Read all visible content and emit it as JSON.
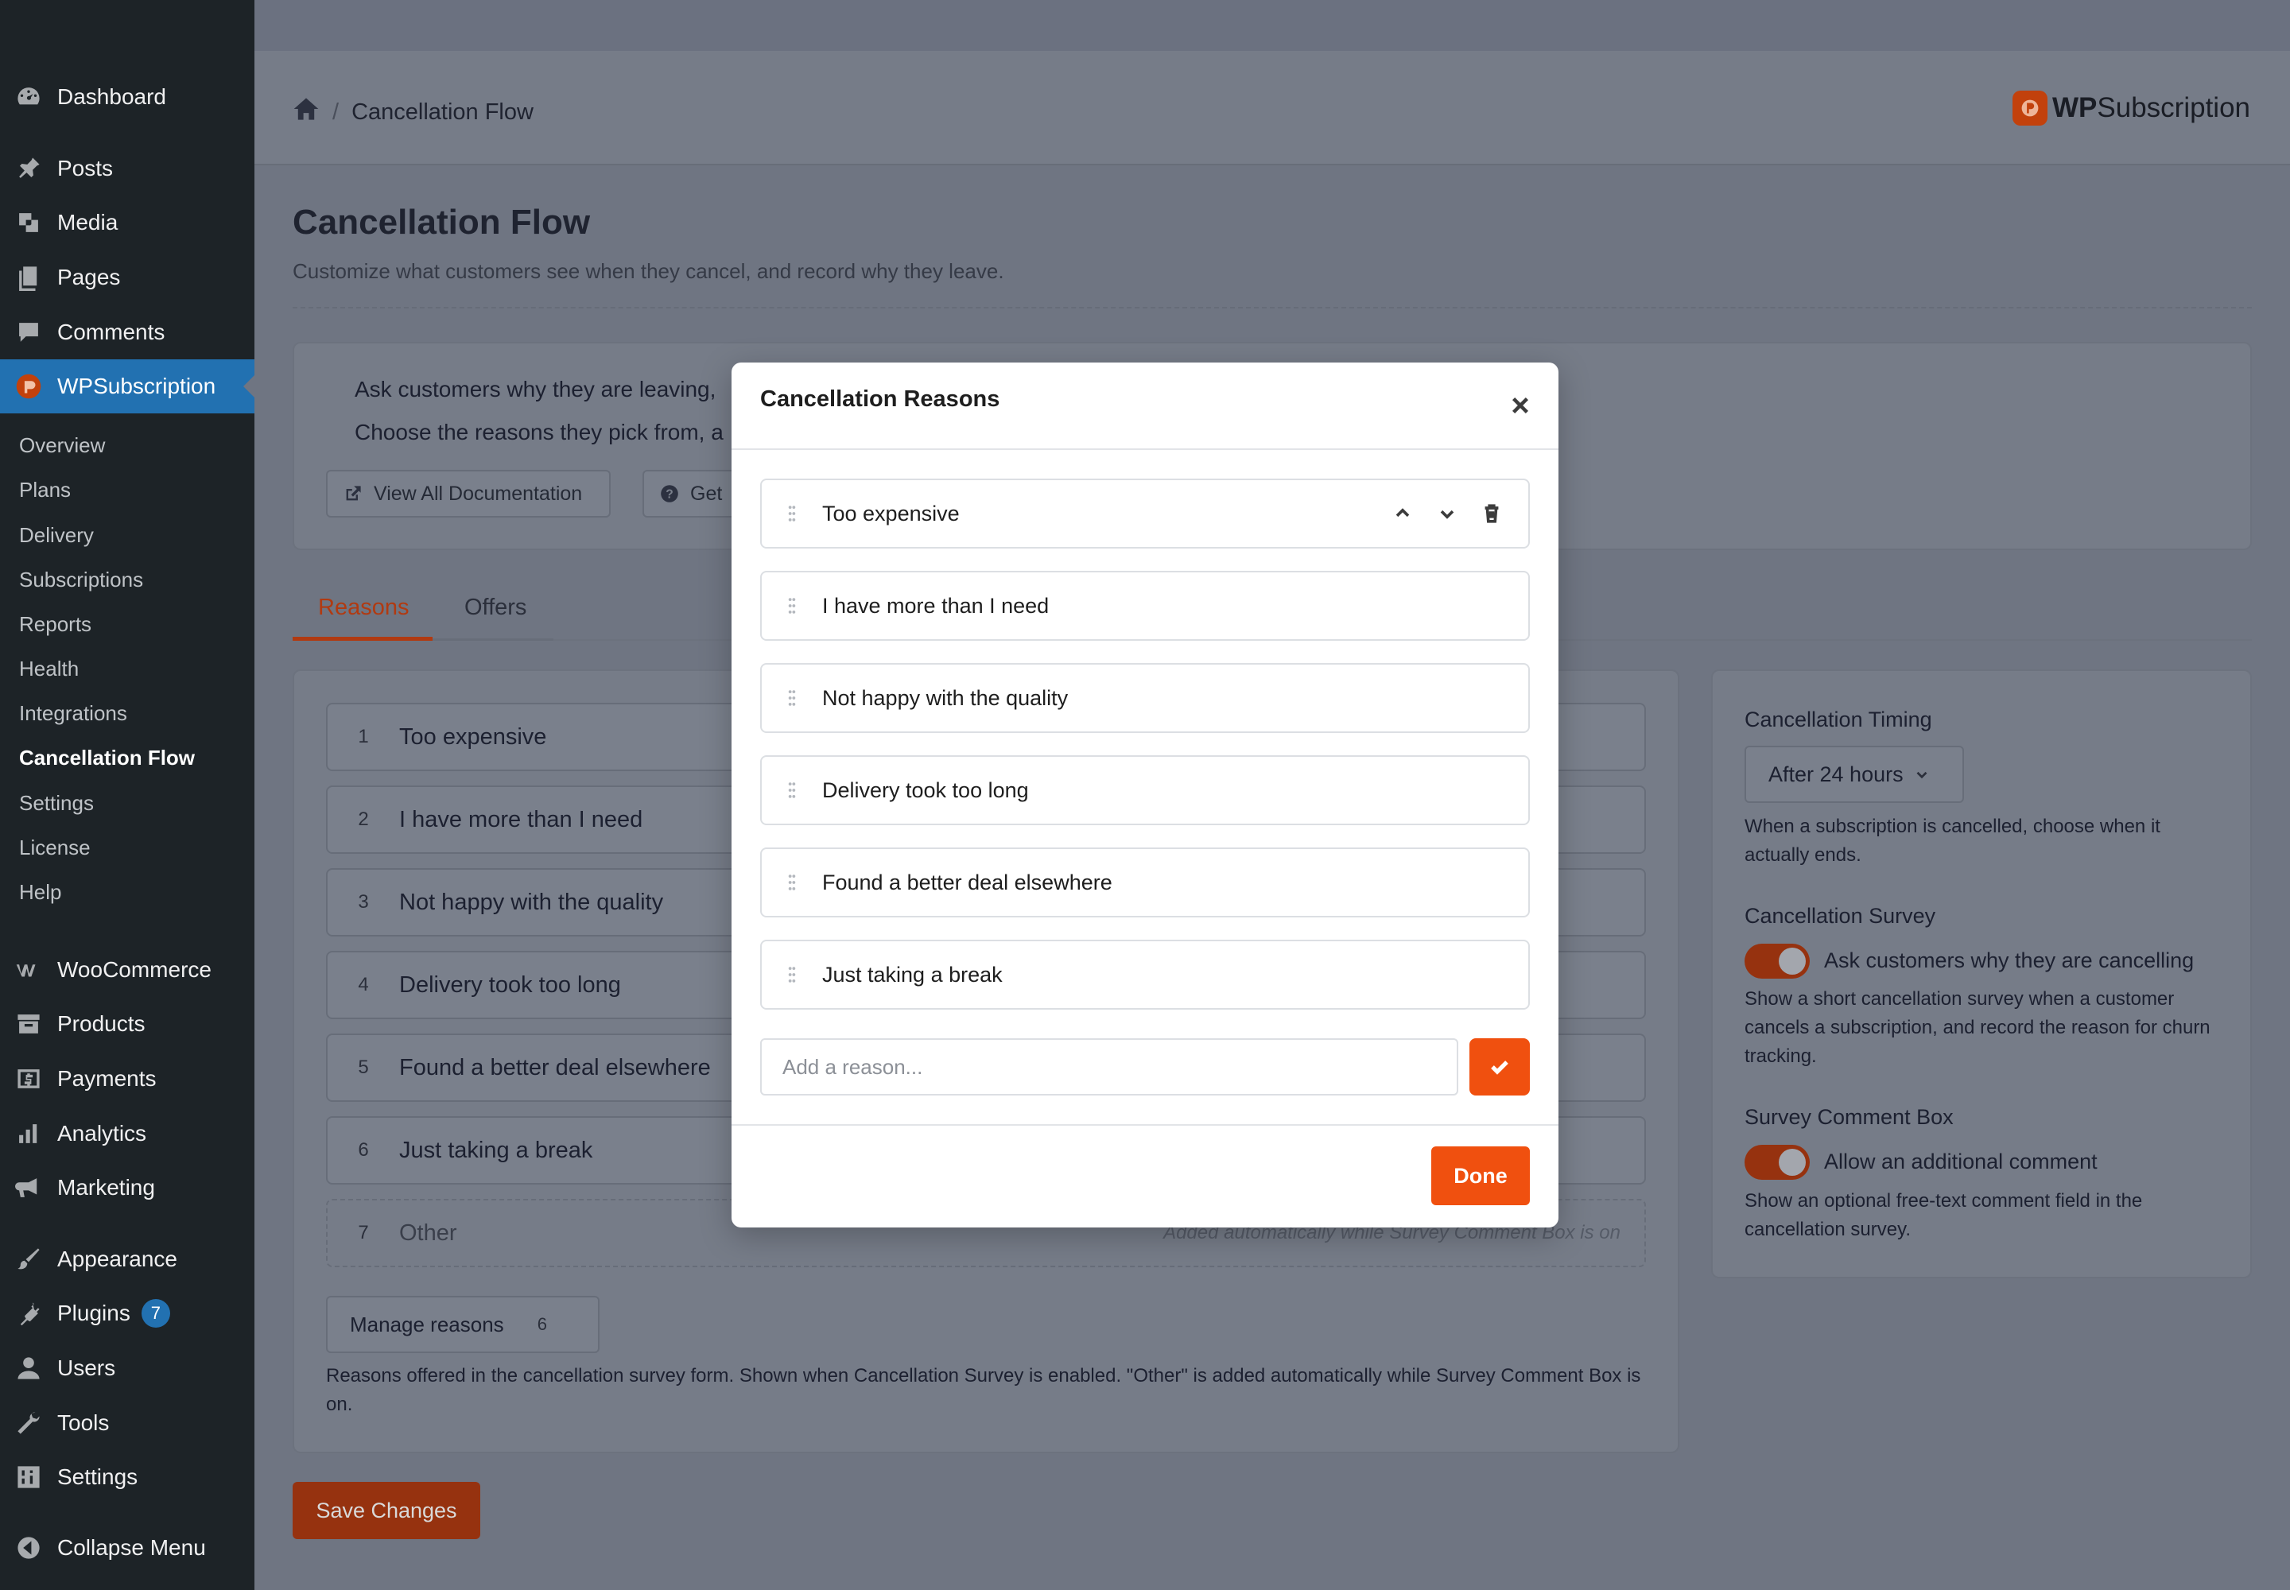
{
  "sidebar": {
    "menu": [
      {
        "label": "Dashboard",
        "icon": "dashboard-icon"
      },
      {
        "label": "Posts",
        "icon": "pin-icon"
      },
      {
        "label": "Media",
        "icon": "media-icon"
      },
      {
        "label": "Pages",
        "icon": "pages-icon"
      },
      {
        "label": "Comments",
        "icon": "comment-icon"
      },
      {
        "label": "WPSubscription",
        "icon": "wpsubscription-icon"
      }
    ],
    "submenu": [
      "Overview",
      "Plans",
      "Delivery",
      "Subscriptions",
      "Reports",
      "Health",
      "Integrations",
      "Cancellation Flow",
      "Settings",
      "License",
      "Help"
    ],
    "menu2": [
      {
        "label": "WooCommerce",
        "icon": "woocommerce-icon"
      },
      {
        "label": "Products",
        "icon": "archive-icon"
      },
      {
        "label": "Payments",
        "icon": "dollar-icon"
      },
      {
        "label": "Analytics",
        "icon": "chart-icon"
      },
      {
        "label": "Marketing",
        "icon": "megaphone-icon"
      },
      {
        "label": "Appearance",
        "icon": "brush-icon"
      },
      {
        "label": "Plugins",
        "icon": "plugin-icon",
        "badge": "7"
      },
      {
        "label": "Users",
        "icon": "user-icon"
      },
      {
        "label": "Tools",
        "icon": "wrench-icon"
      },
      {
        "label": "Settings",
        "icon": "settings-icon"
      },
      {
        "label": "Collapse Menu",
        "icon": "collapse-icon"
      }
    ]
  },
  "header": {
    "breadcrumb": "Cancellation Flow",
    "brand_bold": "WP",
    "brand_rest": "Subscription"
  },
  "page": {
    "title": "Cancellation Flow",
    "subtitle": "Customize what customers see when they cancel, and record why they leave."
  },
  "info": {
    "line1": "Ask customers why they are leaving,",
    "line2": "Choose the reasons they pick from, a",
    "docs_button": "View All Documentation",
    "help_button": "Get"
  },
  "tabs": {
    "reasons": "Reasons",
    "offers": "Offers"
  },
  "reasons": [
    {
      "num": "1",
      "label": "Too expensive"
    },
    {
      "num": "2",
      "label": "I have more than I need"
    },
    {
      "num": "3",
      "label": "Not happy with the quality"
    },
    {
      "num": "4",
      "label": "Delivery took too long"
    },
    {
      "num": "5",
      "label": "Found a better deal elsewhere"
    },
    {
      "num": "6",
      "label": "Just taking a break"
    },
    {
      "num": "7",
      "label": "Other",
      "note": "Added automatically while Survey Comment Box is on"
    }
  ],
  "manage": {
    "label": "Manage reasons",
    "count": "6"
  },
  "reasons_desc": "Reasons offered in the cancellation survey form. Shown when Cancellation Survey is enabled. \"Other\" is added automatically while Survey Comment Box is on.",
  "save_label": "Save Changes",
  "settings": {
    "timing_label": "Cancellation Timing",
    "timing_value": "After 24 hours",
    "timing_help": "When a subscription is cancelled, choose when it actually ends.",
    "survey_label": "Cancellation Survey",
    "survey_toggle": "Ask customers why they are cancelling",
    "survey_help": "Show a short cancellation survey when a customer cancels a subscription, and record the reason for churn tracking.",
    "comment_label": "Survey Comment Box",
    "comment_toggle": "Allow an additional comment",
    "comment_help": "Show an optional free-text comment field in the cancellation survey."
  },
  "modal": {
    "title": "Cancellation Reasons",
    "reasons": [
      "Too expensive",
      "I have more than I need",
      "Not happy with the quality",
      "Delivery took too long",
      "Found a better deal elsewhere",
      "Just taking a break"
    ],
    "input_placeholder": "Add a reason...",
    "done_label": "Done"
  },
  "colors": {
    "accent": "#f0500f",
    "sidebar_bg": "#1d2327",
    "active_menu": "#2271b1"
  }
}
